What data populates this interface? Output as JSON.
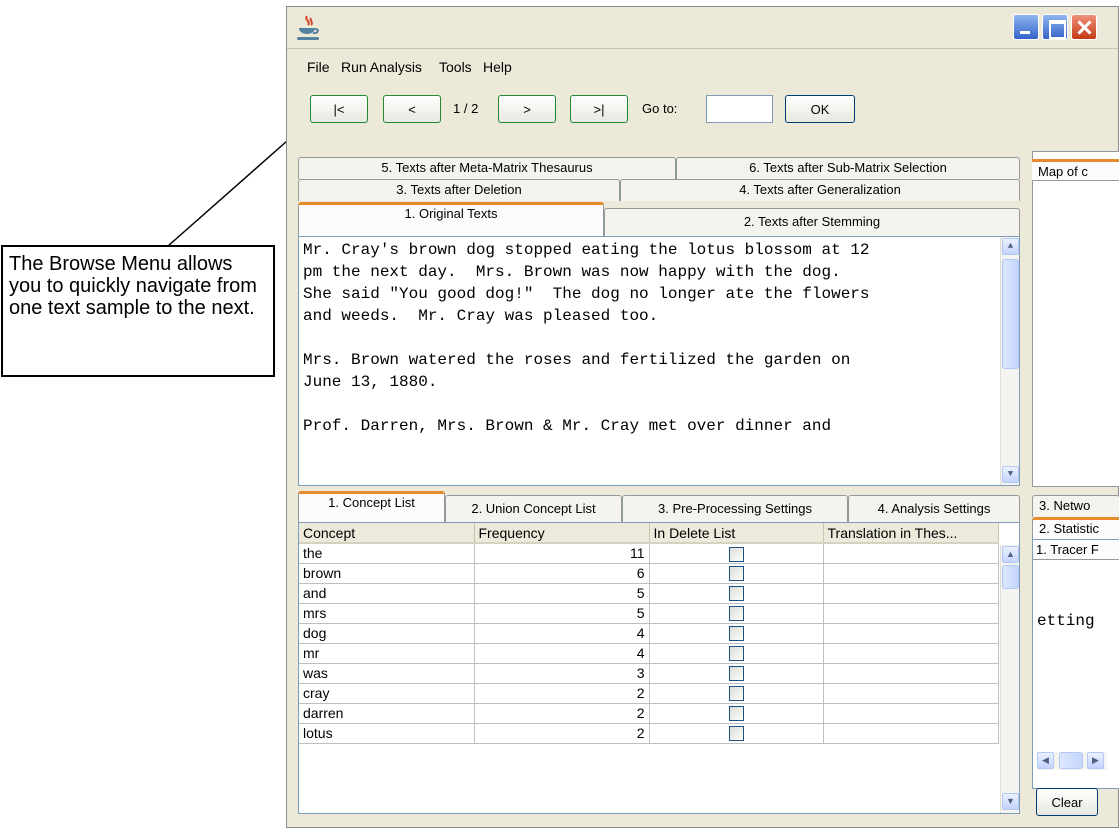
{
  "callout": {
    "text": "The Browse Menu allows you to quickly navigate from one text sample to the next."
  },
  "window": {
    "title": "",
    "icon": "java-cup-icon"
  },
  "menu": {
    "items": [
      "File",
      "Run Analysis",
      "Tools",
      "Help"
    ]
  },
  "browse": {
    "first_label": "|<",
    "prev_label": "<",
    "page": "1 / 2",
    "next_label": ">",
    "last_label": ">|",
    "goto_label": "Go to:",
    "goto_value": "",
    "ok_label": "OK"
  },
  "text_tabs": {
    "row1": [
      "5. Texts after Meta-Matrix Thesaurus",
      "6. Texts after Sub-Matrix Selection"
    ],
    "row2": [
      "3. Texts after Deletion",
      "4. Texts after Generalization"
    ],
    "row3": [
      "1. Original Texts",
      "2. Texts after Stemming"
    ],
    "active": "1. Original Texts"
  },
  "text_content": {
    "lines": [
      "Mr. Cray's brown dog stopped eating the lotus blossom at 12",
      "pm the next day.  Mrs. Brown was now happy with the dog.",
      "She said \"You good dog!\"  The dog no longer ate the flowers",
      "and weeds.  Mr. Cray was pleased too.",
      "",
      "Mrs. Brown watered the roses and fertilized the garden on",
      "June 13, 1880.",
      "",
      "Prof. Darren, Mrs. Brown & Mr. Cray met over dinner and"
    ]
  },
  "right_top": {
    "tab": "Map of c"
  },
  "lower_tabs": {
    "items": [
      "1. Concept List",
      "2. Union Concept List",
      "3. Pre-Processing Settings",
      "4. Analysis Settings"
    ],
    "active": "1. Concept List"
  },
  "concept_table": {
    "headers": [
      "Concept",
      "Frequency",
      "In Delete List",
      "Translation in Thes..."
    ],
    "rows": [
      {
        "concept": "the",
        "frequency": "11"
      },
      {
        "concept": "brown",
        "frequency": "6"
      },
      {
        "concept": "and",
        "frequency": "5"
      },
      {
        "concept": "mrs",
        "frequency": "5"
      },
      {
        "concept": "dog",
        "frequency": "4"
      },
      {
        "concept": "mr",
        "frequency": "4"
      },
      {
        "concept": "was",
        "frequency": "3"
      },
      {
        "concept": "cray",
        "frequency": "2"
      },
      {
        "concept": "darren",
        "frequency": "2"
      },
      {
        "concept": "lotus",
        "frequency": "2"
      }
    ]
  },
  "right_bottom": {
    "tab1": "3. Netwo",
    "tab2": "2. Statistic",
    "tab3": "1. Tracer F",
    "content": "etting",
    "clear_label": "Clear"
  },
  "colors": {
    "window_bg": "#ece9d8",
    "active_tab_accent": "#e68b2c",
    "nav_button_border": "#1f8a34"
  }
}
